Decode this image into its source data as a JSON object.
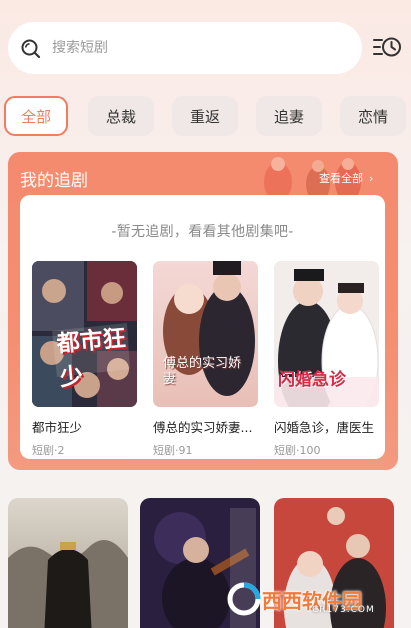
{
  "search": {
    "placeholder": "搜索短剧"
  },
  "tabs": [
    {
      "label": "全部",
      "active": true
    },
    {
      "label": "总裁",
      "active": false
    },
    {
      "label": "重返",
      "active": false
    },
    {
      "label": "追妻",
      "active": false
    },
    {
      "label": "恋情",
      "active": false
    }
  ],
  "follow": {
    "title": "我的追剧",
    "view_all": "查看全部",
    "empty_text": "-暂无追剧，看看其他剧集吧-",
    "dramas": [
      {
        "name": "都市狂少",
        "meta": "短剧·2",
        "poster_text": "都市狂少"
      },
      {
        "name": "傅总的实习娇妻...",
        "meta": "短剧·91",
        "poster_text": "傅总的实习娇妻"
      },
      {
        "name": "闪婚急诊，唐医生",
        "meta": "短剧·100",
        "poster_text": "闪婚急诊"
      }
    ]
  },
  "watermark": {
    "text": "西西软件园",
    "sub": "CR173.COM"
  },
  "colors": {
    "accent": "#f07d62",
    "card_bg": "#f48a6e"
  }
}
